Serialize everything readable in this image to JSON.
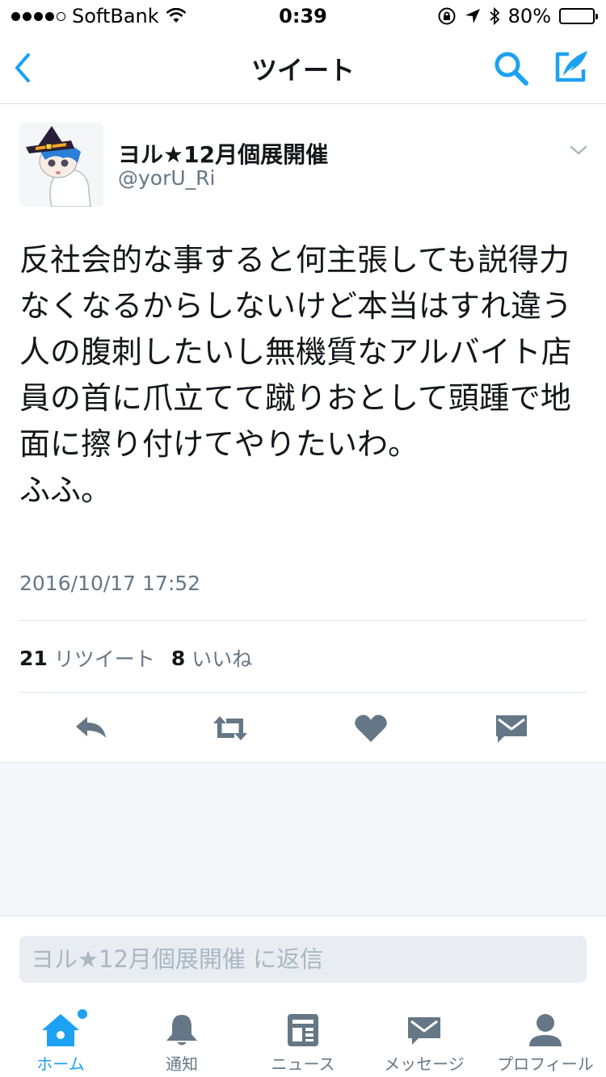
{
  "status_bar": {
    "carrier": "SoftBank",
    "time": "0:39",
    "battery": "80%",
    "battery_level": 0.8
  },
  "nav": {
    "title": "ツイート",
    "icons": [
      "back-icon",
      "search-icon",
      "compose-icon"
    ]
  },
  "tweet": {
    "author_name": "ヨル★12月個展開催",
    "handle": "@yorU_Ri",
    "text": "反社会的な事すると何主張しても説得力なくなるからしないけど本当はすれ違う人の腹刺したいし無機質なアルバイト店員の首に爪立てて蹴りおとして頭踵で地面に擦り付けてやりたいわ。\nふふ。",
    "timestamp": "2016/10/17 17:52",
    "retweets": "21",
    "retweets_label": "リツイート",
    "likes": "8",
    "likes_label": "いいね"
  },
  "actions": [
    "reply-icon",
    "retweet-icon",
    "like-icon",
    "direct-message-icon"
  ],
  "reply": {
    "placeholder": "ヨル★12月個展開催 に返信"
  },
  "tabs": [
    {
      "label": "ホーム",
      "icon": "home-icon",
      "active": true
    },
    {
      "label": "通知",
      "icon": "bell-icon",
      "active": false
    },
    {
      "label": "ニュース",
      "icon": "news-icon",
      "active": false
    },
    {
      "label": "メッセージ",
      "icon": "mail-icon",
      "active": false
    },
    {
      "label": "プロフィール",
      "icon": "profile-icon",
      "active": false
    }
  ],
  "colors": {
    "accent": "#1da1f2",
    "text_primary": "#14171a",
    "text_secondary": "#657786",
    "action_icon": "#657786",
    "background_gray": "#f5f8fa"
  }
}
